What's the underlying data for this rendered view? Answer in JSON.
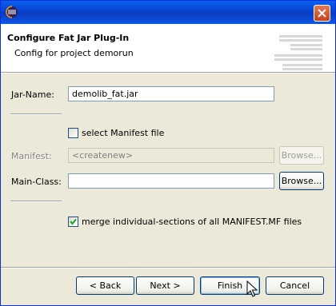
{
  "window": {
    "icon": "eclipse-icon",
    "close_icon": "close-icon"
  },
  "banner": {
    "title": "Configure Fat Jar Plug-In",
    "subtitle": "Config for project demorun"
  },
  "form": {
    "jar_name_label": "Jar-Name:",
    "jar_name_value": "demolib_fat.jar",
    "select_manifest_label": "select Manifest file",
    "select_manifest_checked": false,
    "manifest_label": "Manifest:",
    "manifest_value": "<createnew>",
    "manifest_browse": "Browse...",
    "main_class_label": "Main-Class:",
    "main_class_value": "",
    "main_class_browse": "Browse...",
    "merge_label": "merge individual-sections of all MANIFEST.MF files",
    "merge_checked": true
  },
  "buttons": {
    "back": "< Back",
    "next": "Next >",
    "finish": "Finish",
    "cancel": "Cancel"
  },
  "colors": {
    "title_bar": "#0a5fef",
    "dialog_bg": "#ece9d8",
    "button_border": "#003c74"
  }
}
